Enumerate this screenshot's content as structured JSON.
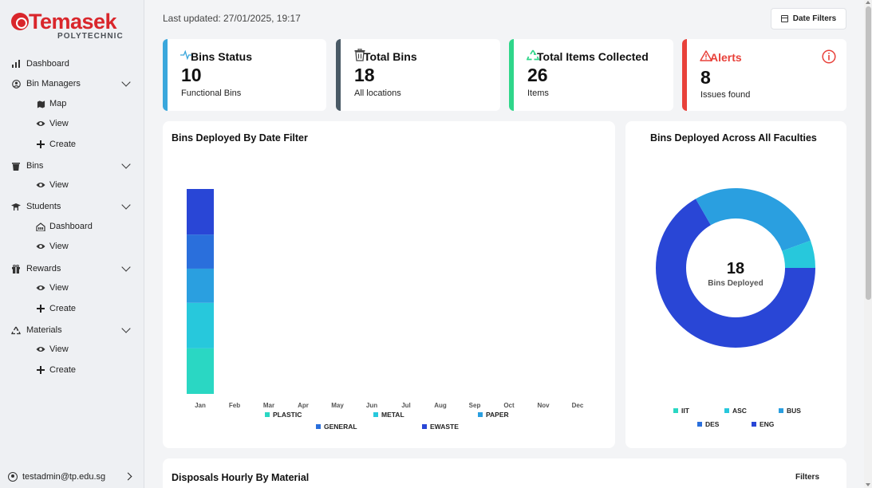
{
  "logo": {
    "word": "Temasek",
    "sub": "POLYTECHNIC"
  },
  "sidebar": {
    "items": [
      {
        "label": "Dashboard",
        "icon": "bar-chart-icon"
      },
      {
        "label": "Bin Managers",
        "icon": "user-circle-icon",
        "children": [
          {
            "label": "Map",
            "icon": "map-icon"
          },
          {
            "label": "View",
            "icon": "eye-icon"
          },
          {
            "label": "Create",
            "icon": "plus-icon"
          }
        ]
      },
      {
        "label": "Bins",
        "icon": "trash-icon",
        "children": [
          {
            "label": "View",
            "icon": "eye-icon"
          }
        ]
      },
      {
        "label": "Students",
        "icon": "graduation-cap-icon",
        "children": [
          {
            "label": "Dashboard",
            "icon": "building-icon"
          },
          {
            "label": "View",
            "icon": "eye-icon"
          }
        ]
      },
      {
        "label": "Rewards",
        "icon": "gift-icon",
        "children": [
          {
            "label": "View",
            "icon": "eye-icon"
          },
          {
            "label": "Create",
            "icon": "plus-icon"
          }
        ]
      },
      {
        "label": "Materials",
        "icon": "recycle-icon",
        "children": [
          {
            "label": "View",
            "icon": "eye-icon"
          },
          {
            "label": "Create",
            "icon": "plus-icon"
          }
        ]
      }
    ],
    "user_email": "testadmin@tp.edu.sg"
  },
  "header": {
    "last_updated": "Last updated: 27/01/2025, 19:17",
    "date_filters_label": "Date Filters"
  },
  "cards": [
    {
      "title": "Bins Status",
      "value": "10",
      "sub": "Functional Bins",
      "accent": "#3aa7dc",
      "icon": "activity-icon"
    },
    {
      "title": "Total Bins",
      "value": "18",
      "sub": "All locations",
      "accent": "#4a5a66",
      "icon": "trash-icon"
    },
    {
      "title": "Total Items Collected",
      "value": "26",
      "sub": "Items",
      "accent": "#2fd68a",
      "icon": "recycle-icon"
    },
    {
      "title": "Alerts",
      "value": "8",
      "sub": "Issues found",
      "accent": "#e8413a",
      "icon": "warning-icon",
      "title_color": "#e8413a"
    }
  ],
  "bar_panel": {
    "title": "Bins Deployed By Date Filter"
  },
  "donut_panel": {
    "title": "Bins Deployed Across All Faculties",
    "center_value": "18",
    "center_label": "Bins Deployed"
  },
  "bottom_panel": {
    "title": "Disposals Hourly By Material",
    "filters_label": "Filters"
  },
  "chart_data": [
    {
      "type": "bar",
      "stacked": true,
      "categories": [
        "Jan",
        "Feb",
        "Mar",
        "Apr",
        "May",
        "Jun",
        "Jul",
        "Aug",
        "Sep",
        "Oct",
        "Nov",
        "Dec"
      ],
      "series": [
        {
          "name": "PLASTIC",
          "color": "#2ad7c3",
          "values": [
            4,
            0,
            0,
            0,
            0,
            0,
            0,
            0,
            0,
            0,
            0,
            0
          ]
        },
        {
          "name": "METAL",
          "color": "#27c8dc",
          "values": [
            4,
            0,
            0,
            0,
            0,
            0,
            0,
            0,
            0,
            0,
            0,
            0
          ]
        },
        {
          "name": "PAPER",
          "color": "#2a9fe0",
          "values": [
            3,
            0,
            0,
            0,
            0,
            0,
            0,
            0,
            0,
            0,
            0,
            0
          ]
        },
        {
          "name": "GENERAL",
          "color": "#2a6fdc",
          "values": [
            3,
            0,
            0,
            0,
            0,
            0,
            0,
            0,
            0,
            0,
            0,
            0
          ]
        },
        {
          "name": "EWASTE",
          "color": "#2946d6",
          "values": [
            4,
            0,
            0,
            0,
            0,
            0,
            0,
            0,
            0,
            0,
            0,
            0
          ]
        }
      ],
      "ylim": [
        0,
        18
      ],
      "legend_position": "bottom"
    },
    {
      "type": "pie",
      "donut": true,
      "labels": [
        "IIT",
        "ASC",
        "BUS",
        "DES",
        "ENG"
      ],
      "values": [
        0,
        1,
        5,
        0,
        12
      ],
      "colors": [
        "#2ad7c3",
        "#27c8dc",
        "#2a9fe0",
        "#2a6fdc",
        "#2946d6"
      ],
      "legend_position": "bottom"
    }
  ]
}
